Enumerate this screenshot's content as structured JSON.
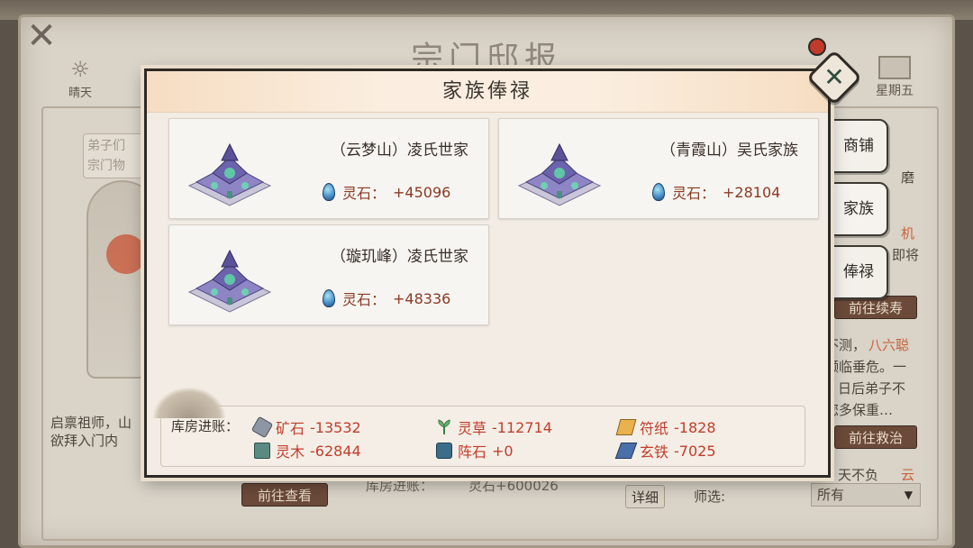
{
  "background": {
    "title": "宗门邸报",
    "weather": "晴天",
    "weekday": "星期五",
    "speech_lines": [
      "弟子们",
      "宗门物"
    ],
    "story_lines": [
      "启禀祖师，山",
      "欲拜入门内"
    ],
    "right_lines": [
      "磨",
      "机",
      "即将",
      "不测，",
      "八六聪",
      "濒临垂危。一",
      "日后弟子不",
      "您多保重…",
      "天不负",
      "云"
    ],
    "btn_view": "前往查看",
    "btn_extend_life": "前往续寿",
    "btn_rescue": "前往救治",
    "btn_detail": "详细",
    "bg_income_text": "库房进账：",
    "bg_income_value": "灵石+600026",
    "filter_label": "师选:",
    "filter_value": "所有"
  },
  "modal": {
    "title": "家族俸禄",
    "close_icon": "close-x-icon"
  },
  "tabs": [
    {
      "label": "商铺",
      "active": false
    },
    {
      "label": "家族",
      "active": true
    },
    {
      "label": "俸禄",
      "active": false
    }
  ],
  "families": [
    {
      "name": "（云梦山）凌氏世家",
      "reward_label": "灵石：",
      "reward_value": "+45096"
    },
    {
      "name": "（青霞山）吴氏家族",
      "reward_label": "灵石：",
      "reward_value": "+28104"
    },
    {
      "name": "（璇玑峰）凌氏世家",
      "reward_label": "灵石：",
      "reward_value": "+48336"
    }
  ],
  "income": {
    "label": "库房进账：",
    "items": [
      {
        "name": "矿石",
        "value": "-13532",
        "icon": "ore-icon"
      },
      {
        "name": "灵草",
        "value": "-112714",
        "icon": "herb-icon"
      },
      {
        "name": "符纸",
        "value": "-1828",
        "icon": "talisman-paper-icon"
      },
      {
        "name": "灵木",
        "value": "-62844",
        "icon": "spirit-wood-icon"
      },
      {
        "name": "阵石",
        "value": "+0",
        "icon": "array-stone-icon"
      },
      {
        "name": "玄铁",
        "value": "-7025",
        "icon": "dark-iron-icon"
      }
    ]
  },
  "colors": {
    "reward_text": "#8a3a22",
    "income_text": "#c23d2c",
    "modal_bg": "#f2ece5",
    "header_bg": "#fbeee0"
  }
}
